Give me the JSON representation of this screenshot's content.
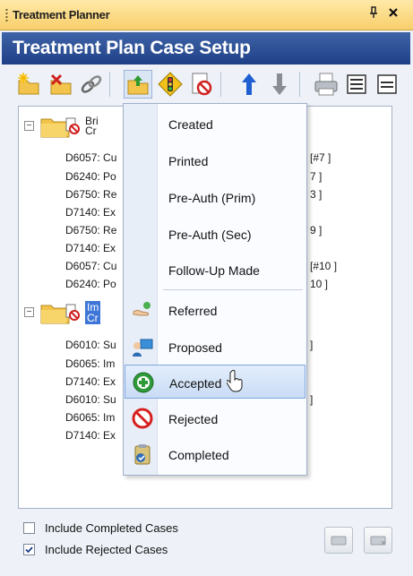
{
  "window": {
    "title": "Treatment Planner",
    "pin_glyph": "p",
    "close_glyph": "✕"
  },
  "header": {
    "title": "Treatment Plan Case Setup"
  },
  "toolbar": {
    "buttons": [
      {
        "name": "new-case-icon"
      },
      {
        "name": "delete-case-icon"
      },
      {
        "name": "link-icon"
      },
      {
        "name": "status-folder-icon"
      },
      {
        "name": "traffic-sign-icon"
      },
      {
        "name": "no-symbol-icon"
      },
      {
        "name": "move-up-arrow-icon"
      },
      {
        "name": "move-down-arrow-icon"
      },
      {
        "name": "printer-icon"
      },
      {
        "name": "list-view-icon"
      },
      {
        "name": "collapse-view-icon"
      }
    ]
  },
  "tree": {
    "cases": [
      {
        "label_line1": "Bri",
        "label_line2": "Cr",
        "items": [
          {
            "code": "D6057: Cu",
            "suffix": "[#7 ]"
          },
          {
            "code": "D6240: Po",
            "suffix": "7 ]"
          },
          {
            "code": "D6750: Re",
            "suffix": "3 ]"
          },
          {
            "code": "D7140: Ex",
            "suffix": ""
          },
          {
            "code": "D6750: Re",
            "suffix": "9 ]"
          },
          {
            "code": "D7140: Ex",
            "suffix": ""
          },
          {
            "code": "D6057: Cu",
            "suffix": "[#10 ]"
          },
          {
            "code": "D6240: Po",
            "suffix": "10 ]"
          }
        ]
      },
      {
        "label_line1": "Im",
        "label_line2": "Cr",
        "items": [
          {
            "code": "D6010: Su",
            "suffix": "]"
          },
          {
            "code": "D6065: Im",
            "suffix": ""
          },
          {
            "code": "D7140: Ex",
            "suffix": ""
          },
          {
            "code": "D6010: Su",
            "suffix": "]"
          },
          {
            "code": "D6065: Im",
            "suffix": ""
          },
          {
            "code": "D7140: Ex",
            "suffix": ""
          }
        ]
      }
    ]
  },
  "context_menu": {
    "items_top": [
      "Created",
      "Printed",
      "Pre-Auth (Prim)",
      "Pre-Auth (Sec)",
      "Follow-Up Made"
    ],
    "items_bottom": [
      {
        "label": "Referred",
        "icon": "referral-hand-icon"
      },
      {
        "label": "Proposed",
        "icon": "proposed-person-icon"
      },
      {
        "label": "Accepted",
        "icon": "accepted-plus-icon"
      },
      {
        "label": "Rejected",
        "icon": "rejected-no-icon"
      },
      {
        "label": "Completed",
        "icon": "completed-clipboard-icon"
      }
    ]
  },
  "options": {
    "include_completed": {
      "label": "Include Completed Cases",
      "checked": false
    },
    "include_rejected": {
      "label": "Include Rejected Cases",
      "checked": true
    }
  },
  "colors": {
    "title_bar": "#f8cf6b",
    "header_band": "#2b4f95",
    "selection": "#3d76d6",
    "menu_hover": "#c9dcf5"
  }
}
